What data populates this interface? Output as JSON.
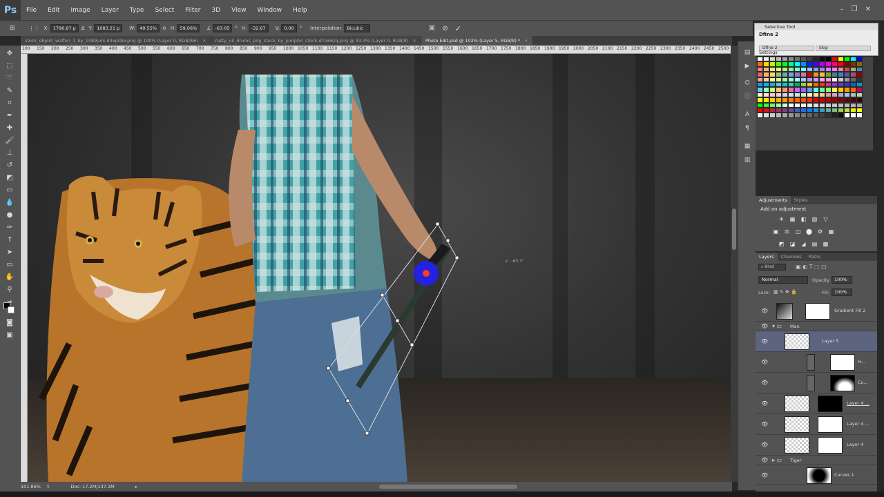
{
  "app": {
    "logo": "Ps"
  },
  "menu": [
    "File",
    "Edit",
    "Image",
    "Layer",
    "Type",
    "Select",
    "Filter",
    "3D",
    "View",
    "Window",
    "Help"
  ],
  "window_controls": {
    "minimize": "–",
    "restore": "❐",
    "close": "✕"
  },
  "options": {
    "x_label": "X:",
    "x_value": "1796.87 p",
    "y_label": "Y:",
    "y_value": "1083.21 p",
    "w_label": "W:",
    "w_value": "49.55%",
    "h_label": "H:",
    "h_value": "59.06%",
    "angle_value": "-63.05",
    "hskew_label": "H:",
    "hskew_value": "-32.67",
    "vskew_label": "V:",
    "vskew_value": "0.00",
    "degree": "°",
    "interpolation_label": "Interpolation:",
    "interpolation_value": "Bicubic"
  },
  "tabs": [
    {
      "label": "stock_objekt_waffen_1_by_1989juni-d4xpsbo.png @ 100% (Layer 0, RGB/8#)",
      "close": "×"
    },
    {
      "label": "rusty_oil_drums_png_stock_by_jumpfer_stock-d7a66zq.png @ 33.3% (Layer 0, RGB/8)",
      "close": "×"
    },
    {
      "label": "Photo Edit.psd @ 102% (Layer 5, RGB/8) *",
      "close": "×"
    }
  ],
  "ruler_ticks": [
    "100",
    "150",
    "200",
    "250",
    "300",
    "350",
    "400",
    "450",
    "500",
    "550",
    "600",
    "650",
    "700",
    "750",
    "800",
    "850",
    "900",
    "950",
    "1000",
    "1050",
    "1100",
    "1150",
    "1200",
    "1250",
    "1300",
    "1350",
    "1400",
    "1450",
    "1500",
    "1550",
    "1600",
    "1650",
    "1700",
    "1750",
    "1800",
    "1850",
    "1900",
    "1950",
    "2000",
    "2050",
    "2100",
    "2150",
    "2200",
    "2250",
    "2300",
    "2350",
    "2400",
    "2450",
    "2500"
  ],
  "canvas": {
    "transform_readout": "∠: -63.3°"
  },
  "status": {
    "zoom": "101.86%",
    "doc": "Doc: 17.2M/137.3M"
  },
  "selective_tool": {
    "title": "Selective Tool",
    "plugin": "Dfine 2",
    "plugin_button": "Dfine 2",
    "skip": "Skip",
    "settings": "Settings"
  },
  "swatch_colors": [
    "#ffffff",
    "#f2f2f2",
    "#d9d9d9",
    "#bfbfbf",
    "#a6a6a6",
    "#8c8c8c",
    "#737373",
    "#595959",
    "#404040",
    "#262626",
    "#0d0d0d",
    "#000000",
    "#ff0000",
    "#ffff00",
    "#00ff00",
    "#00ffff",
    "#0000ff",
    "#ff6a00",
    "#ffd800",
    "#b6ff00",
    "#4cff00",
    "#00ff21",
    "#00ff90",
    "#00ffff",
    "#0094ff",
    "#0026ff",
    "#4800ff",
    "#b200ff",
    "#ff00dc",
    "#ff006e",
    "#ff0000",
    "#7f0000",
    "#7f3300",
    "#7f6a00",
    "#ff8080",
    "#ffb380",
    "#ffe680",
    "#d9ff80",
    "#a6ff80",
    "#80ff99",
    "#80ffcc",
    "#80ffff",
    "#80ccff",
    "#8099ff",
    "#a680ff",
    "#d980ff",
    "#ff80ed",
    "#ff80b3",
    "#c0504d",
    "#9bbb59",
    "#4f81bd",
    "#e06666",
    "#f6b26b",
    "#ffd966",
    "#93c47d",
    "#76a5af",
    "#6fa8dc",
    "#8e7cc3",
    "#c27ba0",
    "#cc0000",
    "#e69138",
    "#f1c232",
    "#6aa84f",
    "#45818e",
    "#3d85c6",
    "#674ea7",
    "#a64d79",
    "#990000",
    "#ff9999",
    "#ffcc99",
    "#ffff99",
    "#ccff99",
    "#99ff99",
    "#99ffcc",
    "#99ffff",
    "#99ccff",
    "#9999ff",
    "#cc99ff",
    "#ff99ff",
    "#ff99cc",
    "#ffffff",
    "#cccccc",
    "#999999",
    "#666666",
    "#333333",
    "#00a0e9",
    "#00b7ee",
    "#1ba8e0",
    "#5bc0de",
    "#00cccc",
    "#33cccc",
    "#00b050",
    "#92d050",
    "#ffc000",
    "#ff6600",
    "#ff3300",
    "#cc3399",
    "#9933cc",
    "#6633cc",
    "#3333cc",
    "#0066cc",
    "#0099cc",
    "#66ccff",
    "#99ffcc",
    "#ccff66",
    "#ffcc66",
    "#ff9966",
    "#ff6699",
    "#cc66ff",
    "#9966ff",
    "#6699ff",
    "#66ffff",
    "#66ff99",
    "#99ff66",
    "#ffff66",
    "#ffcc00",
    "#ff9900",
    "#ff6600",
    "#cc0066",
    "#fff2cc",
    "#fce5cd",
    "#f4cccc",
    "#ead1dc",
    "#d9d2e9",
    "#cfe2f3",
    "#d0e0e3",
    "#d9ead3",
    "#fff2cc",
    "#ffe599",
    "#f9cb9c",
    "#ea9999",
    "#d5a6bd",
    "#b4a7d6",
    "#9fc5e8",
    "#a2c4c9",
    "#b6d7a8",
    "#ffff00",
    "#ffe600",
    "#ffcc00",
    "#ffb300",
    "#ff9900",
    "#ff8000",
    "#ff6600",
    "#ff4d00",
    "#ff3300",
    "#e60000",
    "#cc0000",
    "#b30000",
    "#990000",
    "#800000",
    "#660000",
    "#4d0000",
    "#330000",
    "#00ff00",
    "#33ff33",
    "#66ff66",
    "#99ff99",
    "#ccffcc",
    "#ffffff",
    "#f7f7f7",
    "#efefef",
    "#e7e7e7",
    "#dfdfdf",
    "#d7d7d7",
    "#cfcfcf",
    "#c7c7c7",
    "#bfbfbf",
    "#b7b7b7",
    "#afafaf",
    "#a7a7a7",
    "#ff0000",
    "#e0101f",
    "#c0203f",
    "#a0305f",
    "#80407f",
    "#60509f",
    "#4060bf",
    "#2070df",
    "#0080ff",
    "#2090df",
    "#40a0bf",
    "#60b09f",
    "#80c07f",
    "#a0d05f",
    "#c0e03f",
    "#e0f01f",
    "#ffff00",
    "#ededed",
    "#dcdcdc",
    "#cbcbcb",
    "#bababa",
    "#a9a9a9",
    "#989898",
    "#878787",
    "#767676",
    "#656565",
    "#545454",
    "#434343",
    "#323232",
    "#212121",
    "#101010",
    "#ffffff",
    "#ffffff",
    "#ffffff"
  ],
  "adjustments": {
    "tab_active": "Adjustments",
    "tab_other": "Styles",
    "heading": "Add an adjustment",
    "icons": [
      "☀",
      "▦",
      "◧",
      "▨",
      "▽",
      "▣",
      "⚖",
      "◫",
      "⬤",
      "⚙",
      "▦",
      "◩",
      "◪",
      "◢",
      "▤",
      "▩",
      "▥"
    ]
  },
  "layers": {
    "tabs": [
      "Layers",
      "Channels",
      "Paths"
    ],
    "kind": "⌕ Kind",
    "blend_mode": "Normal",
    "opacity_label": "Opacity:",
    "opacity_value": "100%",
    "lock_label": "Lock:",
    "fill_label": "Fill:",
    "fill_value": "100%",
    "rows": [
      {
        "name": "Gradient Fill 2",
        "type": "fill"
      },
      {
        "name": "Man",
        "type": "group"
      },
      {
        "name": "Layer 5",
        "type": "layer",
        "selected": true
      },
      {
        "name": "H...",
        "type": "adj-mask"
      },
      {
        "name": "Cu...",
        "type": "adj-mask"
      },
      {
        "name": "Layer 4 ...",
        "type": "mask"
      },
      {
        "name": "Layer 4 ...",
        "type": "mask"
      },
      {
        "name": "Layer 4",
        "type": "mask"
      },
      {
        "name": "Tiger",
        "type": "group"
      },
      {
        "name": "Curves 1",
        "type": "adj"
      }
    ]
  },
  "colors": {
    "accent": "#5c6480",
    "chrome": "#535353",
    "dark": "#282828"
  }
}
